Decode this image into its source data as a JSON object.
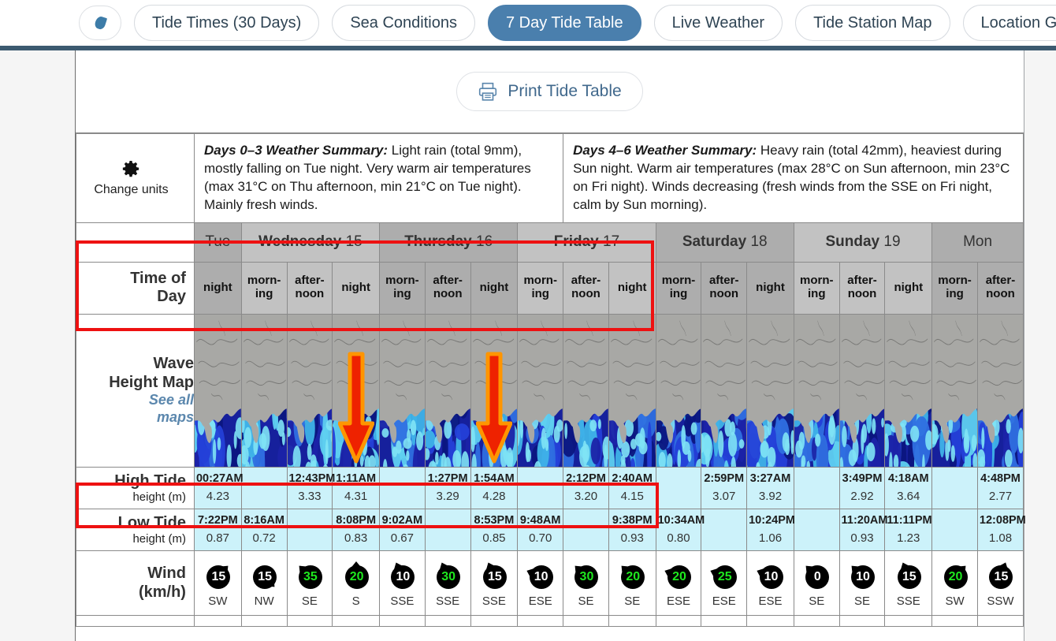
{
  "nav": {
    "logo_icon": "water-drop-icon",
    "items": [
      {
        "label": "Tide Times (30 Days)",
        "active": false
      },
      {
        "label": "Sea Conditions",
        "active": false
      },
      {
        "label": "7 Day Tide Table",
        "active": true
      },
      {
        "label": "Live Weather",
        "active": false
      },
      {
        "label": "Tide Station Map",
        "active": false
      },
      {
        "label": "Location Guide",
        "active": false
      }
    ]
  },
  "toolbar": {
    "print_label": "Print Tide Table",
    "print_icon": "printer-icon"
  },
  "side_labels": {
    "change_units": "Change units",
    "gear_icon": "gear-icon",
    "time_of_day": "Time of Day",
    "time_of_day_l1": "Time of",
    "time_of_day_l2": "Day",
    "wave_map_l1": "Wave",
    "wave_map_l2": "Height Map",
    "wave_map_link_l1": "See all",
    "wave_map_link_l2": "maps",
    "high_tide": "High Tide",
    "low_tide": "Low Tide",
    "height_units": "height (m)",
    "wind_l1": "Wind",
    "wind_l2": "(km/h)"
  },
  "summaries": [
    {
      "title": "Days 0–3 Weather Summary:",
      "text": " Light rain (total 9mm), mostly falling on Tue night. Very warm air temperatures (max 31°C on Thu afternoon, min 21°C on Tue night). Mainly fresh winds."
    },
    {
      "title": "Days 4–6 Weather Summary:",
      "text": " Heavy rain (total 42mm), heaviest during Sun night. Warm air temperatures (max 28°C on Sun afternoon, min 23°C on Fri night). Winds decreasing (fresh winds from the SSE on Fri night, calm by Sun morning)."
    }
  ],
  "days": [
    {
      "name": "Tue",
      "date": "",
      "span": 1,
      "shade": "a"
    },
    {
      "name": "Wednesday",
      "date": "15",
      "span": 3,
      "shade": "b"
    },
    {
      "name": "Thursday",
      "date": "16",
      "span": 3,
      "shade": "a"
    },
    {
      "name": "Friday",
      "date": "17",
      "span": 3,
      "shade": "b"
    },
    {
      "name": "Saturday",
      "date": "18",
      "span": 3,
      "shade": "a"
    },
    {
      "name": "Sunday",
      "date": "19",
      "span": 3,
      "shade": "b"
    },
    {
      "name": "Mon",
      "date": "",
      "span": 2,
      "shade": "a"
    }
  ],
  "columns": [
    {
      "time_of_day": "night",
      "shade": "a"
    },
    {
      "time_of_day": "morn-ing",
      "shade": "b"
    },
    {
      "time_of_day": "after-noon",
      "shade": "b"
    },
    {
      "time_of_day": "night",
      "shade": "b"
    },
    {
      "time_of_day": "morn-ing",
      "shade": "a"
    },
    {
      "time_of_day": "after-noon",
      "shade": "a"
    },
    {
      "time_of_day": "night",
      "shade": "a"
    },
    {
      "time_of_day": "morn-ing",
      "shade": "b"
    },
    {
      "time_of_day": "after-noon",
      "shade": "b"
    },
    {
      "time_of_day": "night",
      "shade": "b"
    },
    {
      "time_of_day": "morn-ing",
      "shade": "a"
    },
    {
      "time_of_day": "after-noon",
      "shade": "a"
    },
    {
      "time_of_day": "night",
      "shade": "a"
    },
    {
      "time_of_day": "morn-ing",
      "shade": "b"
    },
    {
      "time_of_day": "after-noon",
      "shade": "b"
    },
    {
      "time_of_day": "night",
      "shade": "b"
    },
    {
      "time_of_day": "morn-ing",
      "shade": "a"
    },
    {
      "time_of_day": "after-noon",
      "shade": "a"
    }
  ],
  "high_tide": [
    {
      "time": "00:27AM",
      "height": "4.23"
    },
    {
      "time": "",
      "height": ""
    },
    {
      "time": "12:43PM",
      "height": "3.33"
    },
    {
      "time": "1:11AM",
      "height": "4.31"
    },
    {
      "time": "",
      "height": ""
    },
    {
      "time": "1:27PM",
      "height": "3.29"
    },
    {
      "time": "1:54AM",
      "height": "4.28"
    },
    {
      "time": "",
      "height": ""
    },
    {
      "time": "2:12PM",
      "height": "3.20"
    },
    {
      "time": "2:40AM",
      "height": "4.15"
    },
    {
      "time": "",
      "height": ""
    },
    {
      "time": "2:59PM",
      "height": "3.07"
    },
    {
      "time": "3:27AM",
      "height": "3.92"
    },
    {
      "time": "",
      "height": ""
    },
    {
      "time": "3:49PM",
      "height": "2.92"
    },
    {
      "time": "4:18AM",
      "height": "3.64"
    },
    {
      "time": "",
      "height": ""
    },
    {
      "time": "4:48PM",
      "height": "2.77"
    }
  ],
  "low_tide": [
    {
      "time": "7:22PM",
      "height": "0.87"
    },
    {
      "time": "8:16AM",
      "height": "0.72"
    },
    {
      "time": "",
      "height": ""
    },
    {
      "time": "8:08PM",
      "height": "0.83"
    },
    {
      "time": "9:02AM",
      "height": "0.67"
    },
    {
      "time": "",
      "height": ""
    },
    {
      "time": "8:53PM",
      "height": "0.85"
    },
    {
      "time": "9:48AM",
      "height": "0.70"
    },
    {
      "time": "",
      "height": ""
    },
    {
      "time": "9:38PM",
      "height": "0.93"
    },
    {
      "time": "10:34AM",
      "height": "0.80"
    },
    {
      "time": "",
      "height": ""
    },
    {
      "time": "10:24PM",
      "height": "1.06"
    },
    {
      "time": "",
      "height": ""
    },
    {
      "time": "11:20AM",
      "height": "0.93"
    },
    {
      "time": "11:11PM",
      "height": "1.23"
    },
    {
      "time": "",
      "height": ""
    },
    {
      "time": "12:08PM",
      "height": "1.08"
    }
  ],
  "wind": [
    {
      "speed": "15",
      "dir": "SW",
      "bearing": 225
    },
    {
      "speed": "15",
      "dir": "NW",
      "bearing": 315
    },
    {
      "speed": "35",
      "dir": "SE",
      "bearing": 135
    },
    {
      "speed": "20",
      "dir": "S",
      "bearing": 180
    },
    {
      "speed": "10",
      "dir": "SSE",
      "bearing": 157
    },
    {
      "speed": "30",
      "dir": "SSE",
      "bearing": 157
    },
    {
      "speed": "15",
      "dir": "SSE",
      "bearing": 157
    },
    {
      "speed": "10",
      "dir": "ESE",
      "bearing": 112
    },
    {
      "speed": "30",
      "dir": "SE",
      "bearing": 135
    },
    {
      "speed": "20",
      "dir": "SE",
      "bearing": 135
    },
    {
      "speed": "20",
      "dir": "ESE",
      "bearing": 112
    },
    {
      "speed": "25",
      "dir": "ESE",
      "bearing": 112
    },
    {
      "speed": "10",
      "dir": "ESE",
      "bearing": 112
    },
    {
      "speed": "0",
      "dir": "SE",
      "bearing": 135
    },
    {
      "speed": "10",
      "dir": "SE",
      "bearing": 135
    },
    {
      "speed": "15",
      "dir": "SSE",
      "bearing": 157
    },
    {
      "speed": "20",
      "dir": "SW",
      "bearing": 225
    },
    {
      "speed": "15",
      "dir": "SSW",
      "bearing": 202
    }
  ],
  "map_arrows": [
    {
      "column": 3,
      "color": "#ee2200",
      "outline": "#ff9500"
    },
    {
      "column": 6,
      "color": "#ee2200",
      "outline": "#ff9500"
    }
  ],
  "colors": {
    "accent_blue": "#4a7fad",
    "highlight_red": "#ee1111",
    "tide_cell": "#ccf2fa",
    "header_rule": "#3c5a70",
    "wind_fast": "#1ee81e"
  }
}
